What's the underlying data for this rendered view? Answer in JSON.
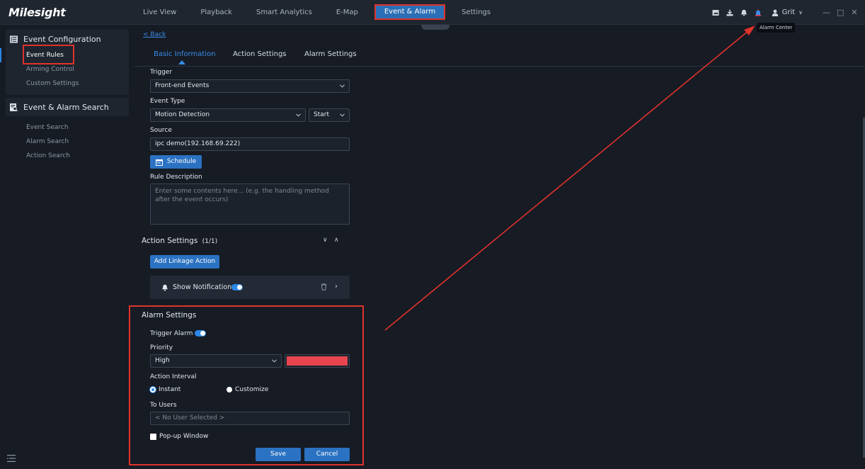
{
  "app": {
    "logo": "Milesight"
  },
  "nav": [
    "Live View",
    "Playback",
    "Smart Analytics",
    "E-Map",
    "Event & Alarm",
    "Settings"
  ],
  "nav_active": "Event & Alarm",
  "user": {
    "name": "Grit"
  },
  "tooltip": "Alarm Center",
  "sidebar": {
    "groups": [
      {
        "title": "Event Configuration",
        "icon": "list-icon",
        "items": [
          "Event Rules",
          "Arming Control",
          "Custom Settings"
        ]
      },
      {
        "title": "Event & Alarm Search",
        "icon": "search-doc-icon",
        "items": [
          "Event Search",
          "Alarm Search",
          "Action Search"
        ]
      }
    ],
    "active_item": "Event Rules"
  },
  "main": {
    "back_label": "< Back",
    "tabs": [
      "Basic Information",
      "Action Settings",
      "Alarm Settings"
    ],
    "active_tab": "Basic Information"
  },
  "basic": {
    "trigger_label": "Trigger",
    "trigger_value": "Front-end Events",
    "event_type_label": "Event Type",
    "event_type_value": "Motion Detection",
    "event_state_value": "Start",
    "source_label": "Source",
    "source_value": "ipc demo(192.168.69.222)",
    "schedule_label": "Schedule",
    "rule_desc_label": "Rule Description",
    "rule_desc_placeholder": "Enter some contents here... (e.g. the handling method after the event occurs)"
  },
  "action": {
    "title": "Action Settings",
    "count": "(1/1)",
    "add_label": "Add Linkage Action",
    "item_label": "Show Notification",
    "item_enabled": true
  },
  "alarm": {
    "title": "Alarm Settings",
    "trigger_label": "Trigger Alarm",
    "trigger_enabled": true,
    "priority_label": "Priority",
    "priority_value": "High",
    "priority_color": "#e8454f",
    "interval_label": "Action Interval",
    "interval_options": [
      "Instant",
      "Customize"
    ],
    "interval_selected": "Instant",
    "users_label": "To Users",
    "users_value": "< No User Selected >",
    "popup_label": "Pop-up Window",
    "popup_checked": false,
    "save_label": "Save",
    "cancel_label": "Cancel"
  },
  "colors": {
    "accent": "#2b88e6",
    "highlight": "#e0322c",
    "background": "#161b24"
  }
}
